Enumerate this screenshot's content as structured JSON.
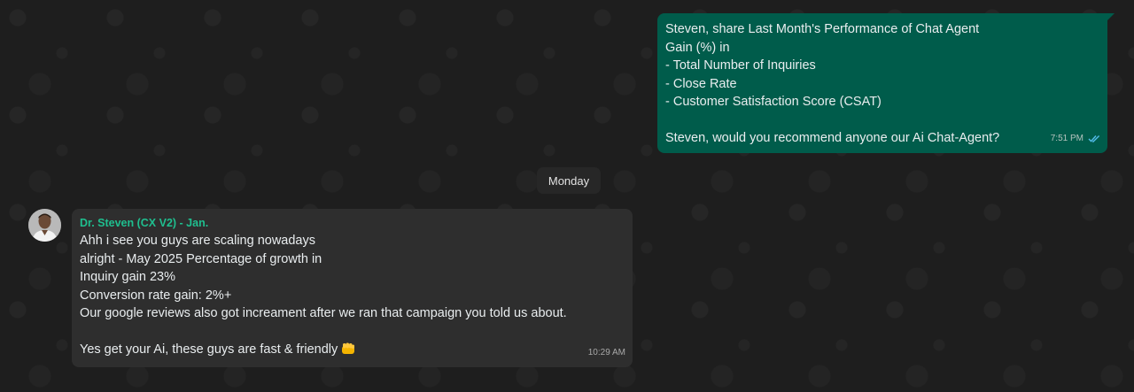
{
  "outgoing_message": {
    "lines": [
      "Steven, share Last Month's Performance of Chat Agent",
      "Gain (%) in",
      "- Total Number of Inquiries",
      "- Close Rate",
      "- Customer Satisfaction Score (CSAT)",
      "",
      "Steven, would you recommend anyone our Ai Chat-Agent?"
    ],
    "time": "7:51 PM",
    "status_icon": "double-check-read-icon",
    "bubble_color": "#005c4b"
  },
  "date_separator": {
    "label": "Monday"
  },
  "incoming_message": {
    "sender": "Dr. Steven (CX V2) - Jan.",
    "sender_color": "#1fbf8f",
    "lines": [
      "Ahh i see you guys are scaling nowadays",
      "alright - May 2025 Percentage of growth in",
      "Inquiry gain 23%",
      "Conversion rate gain: 2%+",
      "Our google reviews also got increament after we ran that campaign you told us about.",
      "",
      "Yes get your Ai, these guys are fast & friendly"
    ],
    "emoji_icon": "fist-bump-icon",
    "time": "10:29 AM",
    "bubble_color": "#2e2e2e"
  },
  "colors": {
    "background": "#1e1e1e",
    "read_tick": "#53bdeb"
  }
}
